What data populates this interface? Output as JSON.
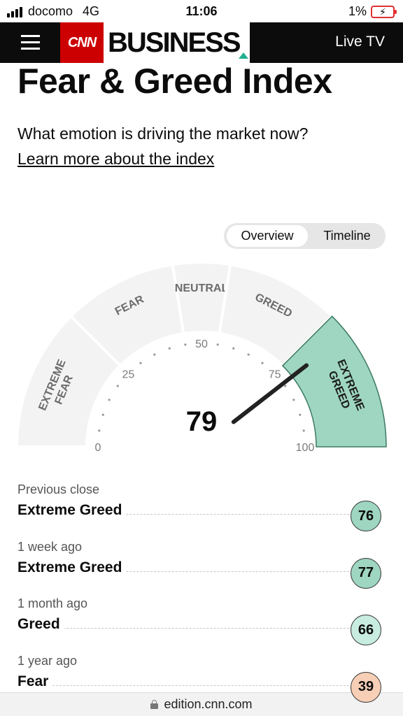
{
  "status": {
    "carrier": "docomo",
    "network": "4G",
    "time": "11:06",
    "battery": "1%",
    "battery_color": "#e0312f"
  },
  "header": {
    "brand_cnn": "CNN",
    "brand_section": "BUSINESS",
    "live_tv": "Live TV",
    "brand_red": "#cc0000"
  },
  "page": {
    "title": "Fear & Greed Index",
    "subtitle": "What emotion is driving the market now?",
    "learn_more": "Learn more about the index"
  },
  "toggle": {
    "overview": "Overview",
    "timeline": "Timeline",
    "active": "Overview"
  },
  "gauge": {
    "value": 79,
    "min": 0,
    "max": 100,
    "ticks": [
      "0",
      "25",
      "50",
      "75",
      "100"
    ],
    "segments": [
      {
        "label": "EXTREME FEAR",
        "range": [
          0,
          25
        ]
      },
      {
        "label": "FEAR",
        "range": [
          25,
          45
        ]
      },
      {
        "label": "NEUTRAL",
        "range": [
          45,
          55
        ]
      },
      {
        "label": "GREED",
        "range": [
          55,
          75
        ]
      },
      {
        "label": "EXTREME GREED",
        "range": [
          75,
          100
        ]
      }
    ],
    "active_segment": "EXTREME GREED",
    "colors": {
      "inactive": "#f3f3f3",
      "active": "#9ed6c1",
      "active_border": "#3d7a62",
      "needle": "#222222"
    }
  },
  "history": [
    {
      "when": "Previous close",
      "label": "Extreme Greed",
      "value": "76",
      "color": "#9ed6c1"
    },
    {
      "when": "1 week ago",
      "label": "Extreme Greed",
      "value": "77",
      "color": "#9ed6c1"
    },
    {
      "when": "1 month ago",
      "label": "Greed",
      "value": "66",
      "color": "#c8ece0"
    },
    {
      "when": "1 year ago",
      "label": "Fear",
      "value": "39",
      "color": "#f7cfb6"
    }
  ],
  "url_bar": {
    "domain": "edition.cnn.com"
  }
}
